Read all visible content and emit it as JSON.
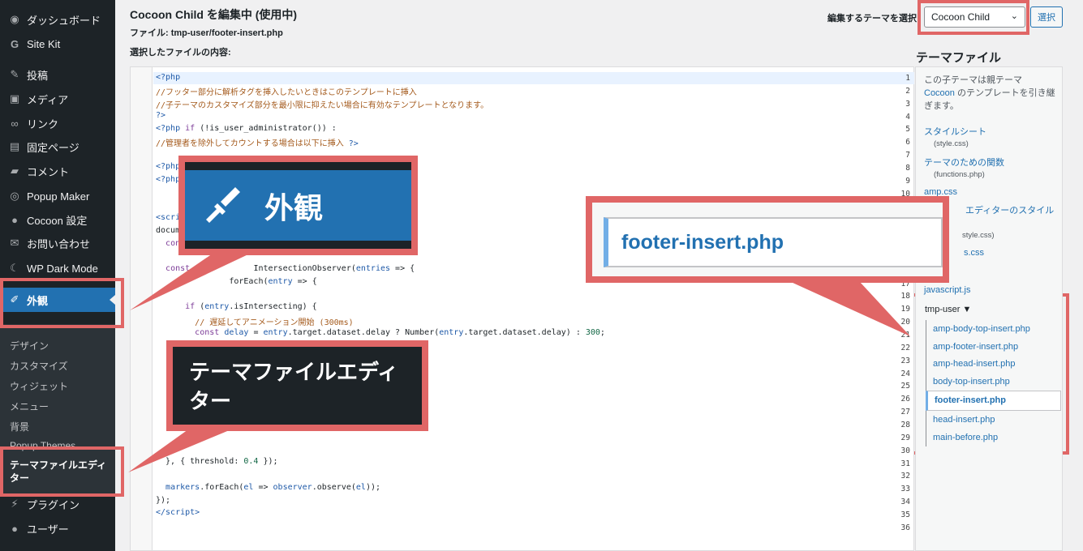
{
  "sidebar": {
    "items": [
      {
        "label": "ダッシュボード",
        "icon": "dashboard-icon"
      },
      {
        "label": "Site Kit",
        "icon": "sitekit-icon"
      },
      {
        "label": "投稿",
        "icon": "pin-icon"
      },
      {
        "label": "メディア",
        "icon": "media-icon"
      },
      {
        "label": "リンク",
        "icon": "link-icon"
      },
      {
        "label": "固定ページ",
        "icon": "page-icon"
      },
      {
        "label": "コメント",
        "icon": "comment-icon"
      },
      {
        "label": "Popup Maker",
        "icon": "popup-icon"
      },
      {
        "label": "Cocoon 設定",
        "icon": "cocoon-icon"
      },
      {
        "label": "お問い合わせ",
        "icon": "mail-icon"
      },
      {
        "label": "WP Dark Mode",
        "icon": "moon-icon"
      },
      {
        "label": "外観",
        "icon": "brush-icon"
      }
    ],
    "submenu": [
      "デザイン",
      "カスタマイズ",
      "ウィジェット",
      "メニュー",
      "背景",
      "Popup Themes"
    ],
    "submenu_current": "テーマファイルエディター",
    "after": [
      {
        "label": "プラグイン",
        "icon": "plugin-icon"
      },
      {
        "label": "ユーザー",
        "icon": "user-icon"
      }
    ]
  },
  "header": {
    "title": "Cocoon Child を編集中 (使用中)",
    "file_line": "ファイル: tmp-user/footer-insert.php",
    "content_label": "選択したファイルの内容:",
    "select_label": "編集するテーマを選択",
    "selected_theme": "Cocoon Child",
    "select_button": "選択"
  },
  "editor": {
    "line_numbers": [
      "1",
      "2",
      "3",
      "4",
      "5",
      "6",
      "7",
      "8",
      "9",
      "10",
      "11",
      "12",
      "13",
      "14",
      "15",
      "16",
      "17",
      "18",
      "19",
      "20",
      "21",
      "22",
      "23",
      "24",
      "25",
      "26",
      "27",
      "28",
      "29",
      "30",
      "31",
      "32",
      "33",
      "34",
      "35",
      "36"
    ]
  },
  "theme_files": {
    "heading": "テーマファイル",
    "intro_prefix": "この子テーマは親テーマ",
    "intro_link": "Cocoon",
    "intro_suffix": "のテンプレートを引き継ぎます。",
    "files": [
      {
        "label": "スタイルシート",
        "sub": "(style.css)"
      },
      {
        "label": "テーマのための関数",
        "sub": "(functions.php)"
      }
    ],
    "amp_css": "amp.css",
    "block_editor_style": "エディターのスタイル",
    "editor_style_sub": "style.css)",
    "css_partial": "s.css",
    "javascript": "javascript.js",
    "folder": "tmp-user ▼",
    "tmp_files": [
      "amp-body-top-insert.php",
      "amp-footer-insert.php",
      "amp-head-insert.php",
      "body-top-insert.php",
      "footer-insert.php",
      "head-insert.php",
      "main-before.php"
    ]
  },
  "callouts": {
    "gaikan": "外観",
    "theme_editor": "テーマファイルエディター",
    "footer_file": "footer-insert.php"
  }
}
